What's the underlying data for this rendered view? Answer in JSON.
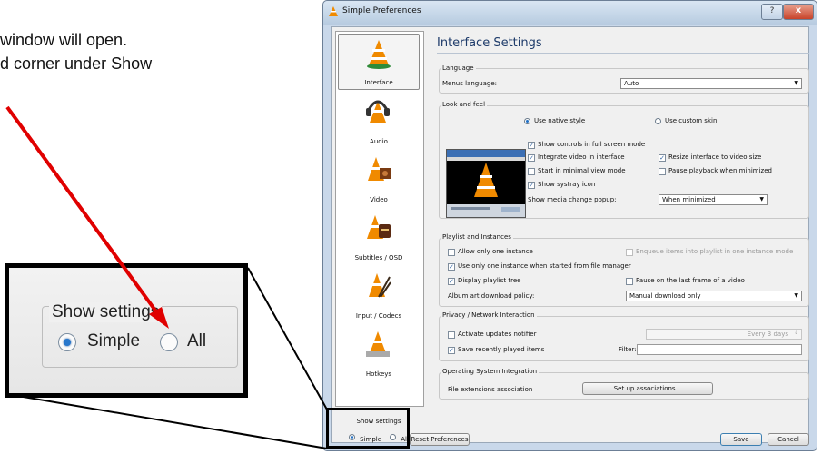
{
  "doc": {
    "line1": "window will open.",
    "line2": "d corner under Show"
  },
  "window": {
    "title": "Simple Preferences",
    "help_label": "?",
    "close_label": "x"
  },
  "sidebar": {
    "items": [
      {
        "label": "Interface"
      },
      {
        "label": "Audio"
      },
      {
        "label": "Video"
      },
      {
        "label": "Subtitles / OSD"
      },
      {
        "label": "Input / Codecs"
      },
      {
        "label": "Hotkeys"
      }
    ],
    "show_settings": {
      "title": "Show settings",
      "simple": "Simple",
      "all": "All",
      "selected": "Simple"
    }
  },
  "main": {
    "title": "Interface Settings",
    "language": {
      "group": "Language",
      "menus_label": "Menus language:",
      "menus_value": "Auto"
    },
    "look": {
      "group": "Look and feel",
      "native": "Use native style",
      "custom": "Use custom skin",
      "show_controls": "Show controls in full screen mode",
      "integrate": "Integrate video in interface",
      "resize": "Resize interface to video size",
      "minimal": "Start in minimal view mode",
      "pause_min": "Pause playback when minimized",
      "systray": "Show systray icon",
      "popup_label": "Show media change popup:",
      "popup_value": "When minimized"
    },
    "playlist": {
      "group": "Playlist and Instances",
      "one_instance": "Allow only one instance",
      "enqueue": "Enqueue items into playlist in one instance mode",
      "one_fm": "Use only one instance when started from file manager",
      "tree": "Display playlist tree",
      "pause_last": "Pause on the last frame of a video",
      "art_label": "Album art download policy:",
      "art_value": "Manual download only"
    },
    "privacy": {
      "group": "Privacy / Network Interaction",
      "updates": "Activate updates notifier",
      "every": "Every 3 days",
      "recent": "Save recently played items",
      "filter": "Filter:"
    },
    "os": {
      "group": "Operating System Integration",
      "ext_label": "File extensions association",
      "setup": "Set up associations..."
    }
  },
  "footer": {
    "reset": "Reset Preferences",
    "save": "Save",
    "cancel": "Cancel"
  },
  "zoom": {
    "title": "Show settings",
    "simple": "Simple",
    "all": "All"
  },
  "colors": {
    "arrow": "#e00000",
    "window_frame": "#c9d8ea",
    "title_color": "#1e3b6a",
    "radio_selected": "#2777cc"
  }
}
